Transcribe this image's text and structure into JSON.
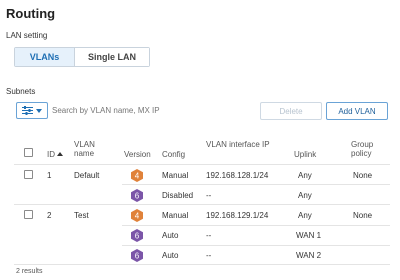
{
  "page": {
    "title": "Routing"
  },
  "lan_setting": {
    "label": "LAN setting",
    "options": [
      "VLANs",
      "Single LAN"
    ],
    "selected": "VLANs"
  },
  "subnets": {
    "label": "Subnets",
    "search_placeholder": "Search by VLAN name, MX IP",
    "delete_label": "Delete",
    "add_label": "Add VLAN"
  },
  "table": {
    "headers": {
      "id": "ID",
      "vlan_name": "VLAN name",
      "version": "Version",
      "config": "Config",
      "vlan_ip": "VLAN interface IP",
      "uplink": "Uplink",
      "group_policy": "Group policy"
    },
    "rows": [
      {
        "id": "1",
        "name": "Default",
        "version": "4",
        "config": "Manual",
        "ip": "192.168.128.1/24",
        "uplink": "Any",
        "policy": "None"
      },
      {
        "id": "",
        "name": "",
        "version": "6",
        "config": "Disabled",
        "ip": "--",
        "uplink": "Any",
        "policy": ""
      },
      {
        "id": "2",
        "name": "Test",
        "version": "4",
        "config": "Manual",
        "ip": "192.168.129.1/24",
        "uplink": "Any",
        "policy": "None"
      },
      {
        "id": "",
        "name": "",
        "version": "6",
        "config": "Auto",
        "ip": "--",
        "uplink": "WAN 1",
        "policy": ""
      },
      {
        "id": "",
        "name": "",
        "version": "6",
        "config": "Auto",
        "ip": "--",
        "uplink": "WAN 2",
        "policy": ""
      }
    ]
  },
  "footer": {
    "results": "2 results"
  },
  "colors": {
    "ipv4": "#e0823a",
    "ipv6": "#7b55a8",
    "accent": "#1e6fb4"
  },
  "icons": {
    "filter": "sliders-icon",
    "hex": "hexagon-icon"
  }
}
